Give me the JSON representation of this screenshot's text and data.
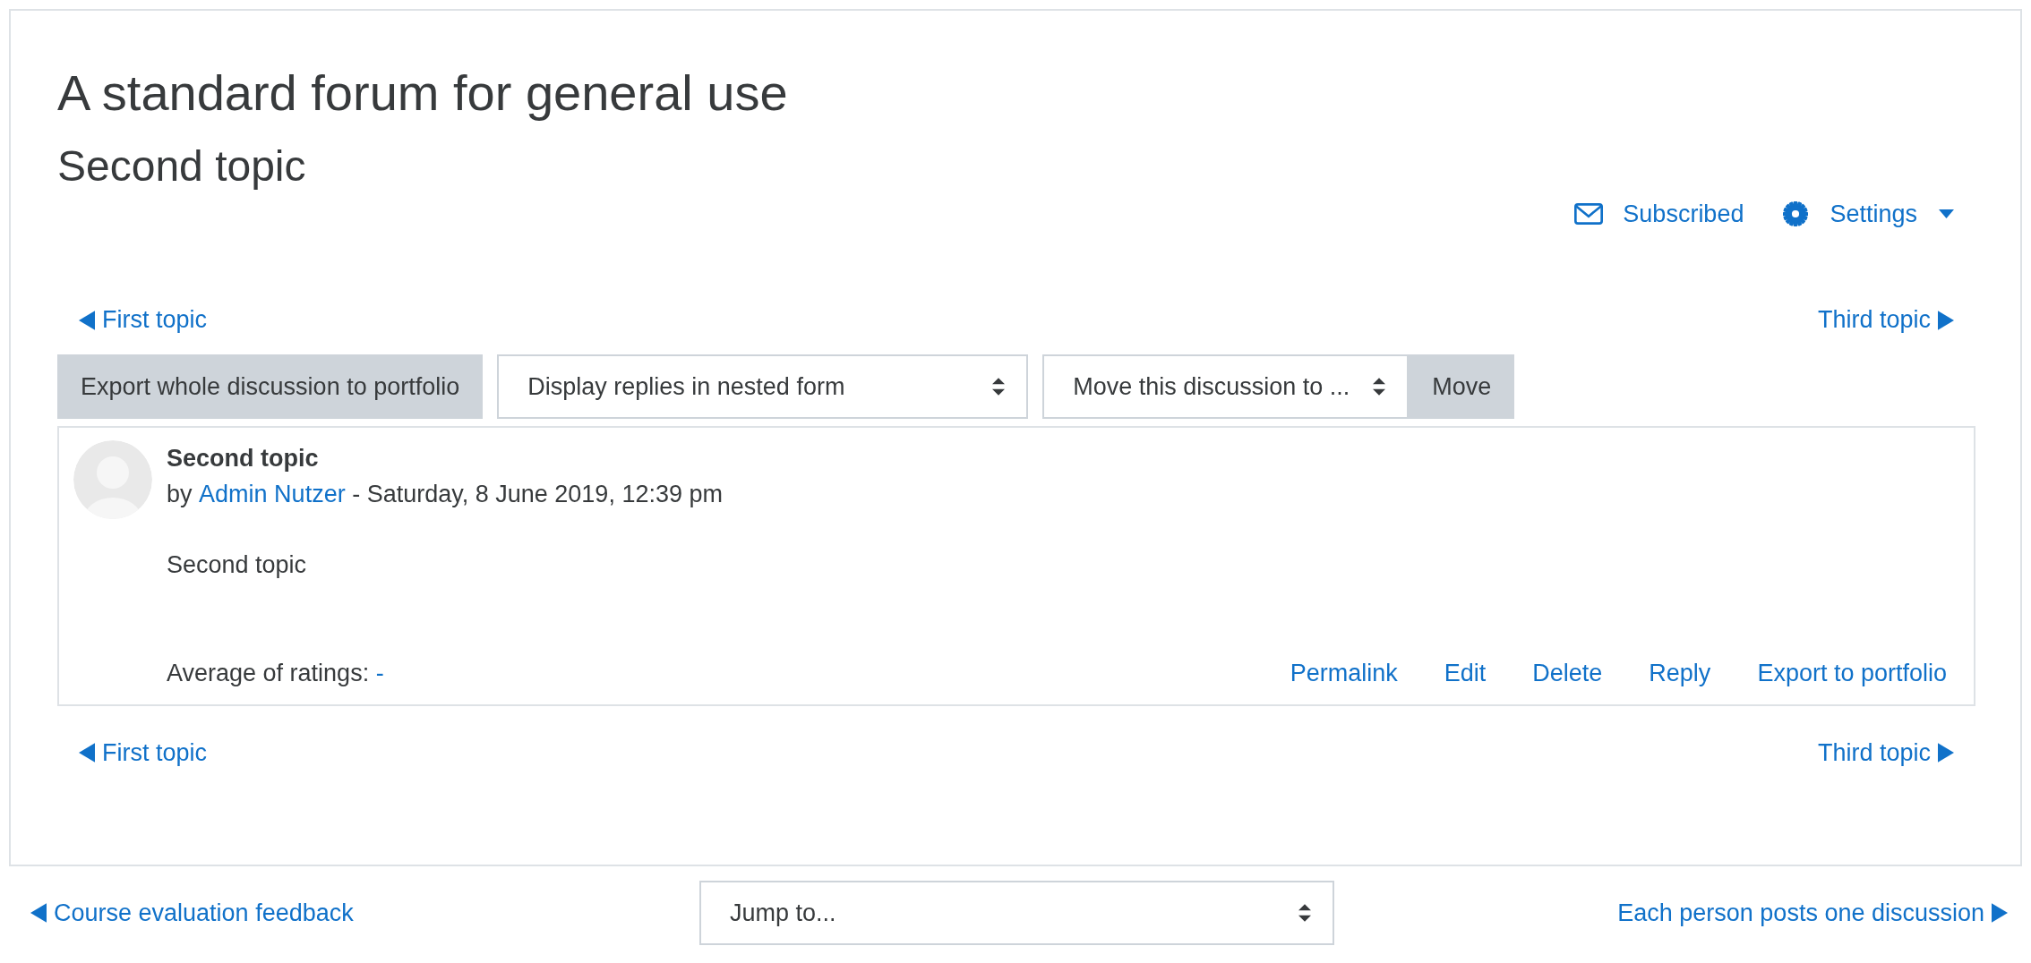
{
  "forum_title": "A standard forum for general use",
  "discussion_title": "Second topic",
  "actions": [
    {
      "kind": "subscribe",
      "label": "Subscribed"
    },
    {
      "kind": "settings",
      "label": "Settings"
    }
  ],
  "top_nav": {
    "previous": "First topic",
    "next": "Third topic"
  },
  "toolbar": {
    "export_button": "Export whole discussion to portfolio",
    "display_select": "Display replies in nested form",
    "move_select": "Move this discussion to ...",
    "move_button": "Move"
  },
  "post": {
    "subject": "Second topic",
    "by": "by",
    "author": "Admin Nutzer",
    "date": "- Saturday, 8 June 2019, 12:39 pm",
    "body": "Second topic",
    "ratings_label": "Average of ratings:",
    "ratings_value": "-",
    "links": [
      "Permalink",
      "Edit",
      "Delete",
      "Reply",
      "Export to portfolio"
    ]
  },
  "bottom_nav": {
    "previous": "First topic",
    "next": "Third topic"
  },
  "footer": {
    "previous": "Course evaluation feedback",
    "jump_select": "Jump to...",
    "next": "Each person posts one discussion"
  }
}
